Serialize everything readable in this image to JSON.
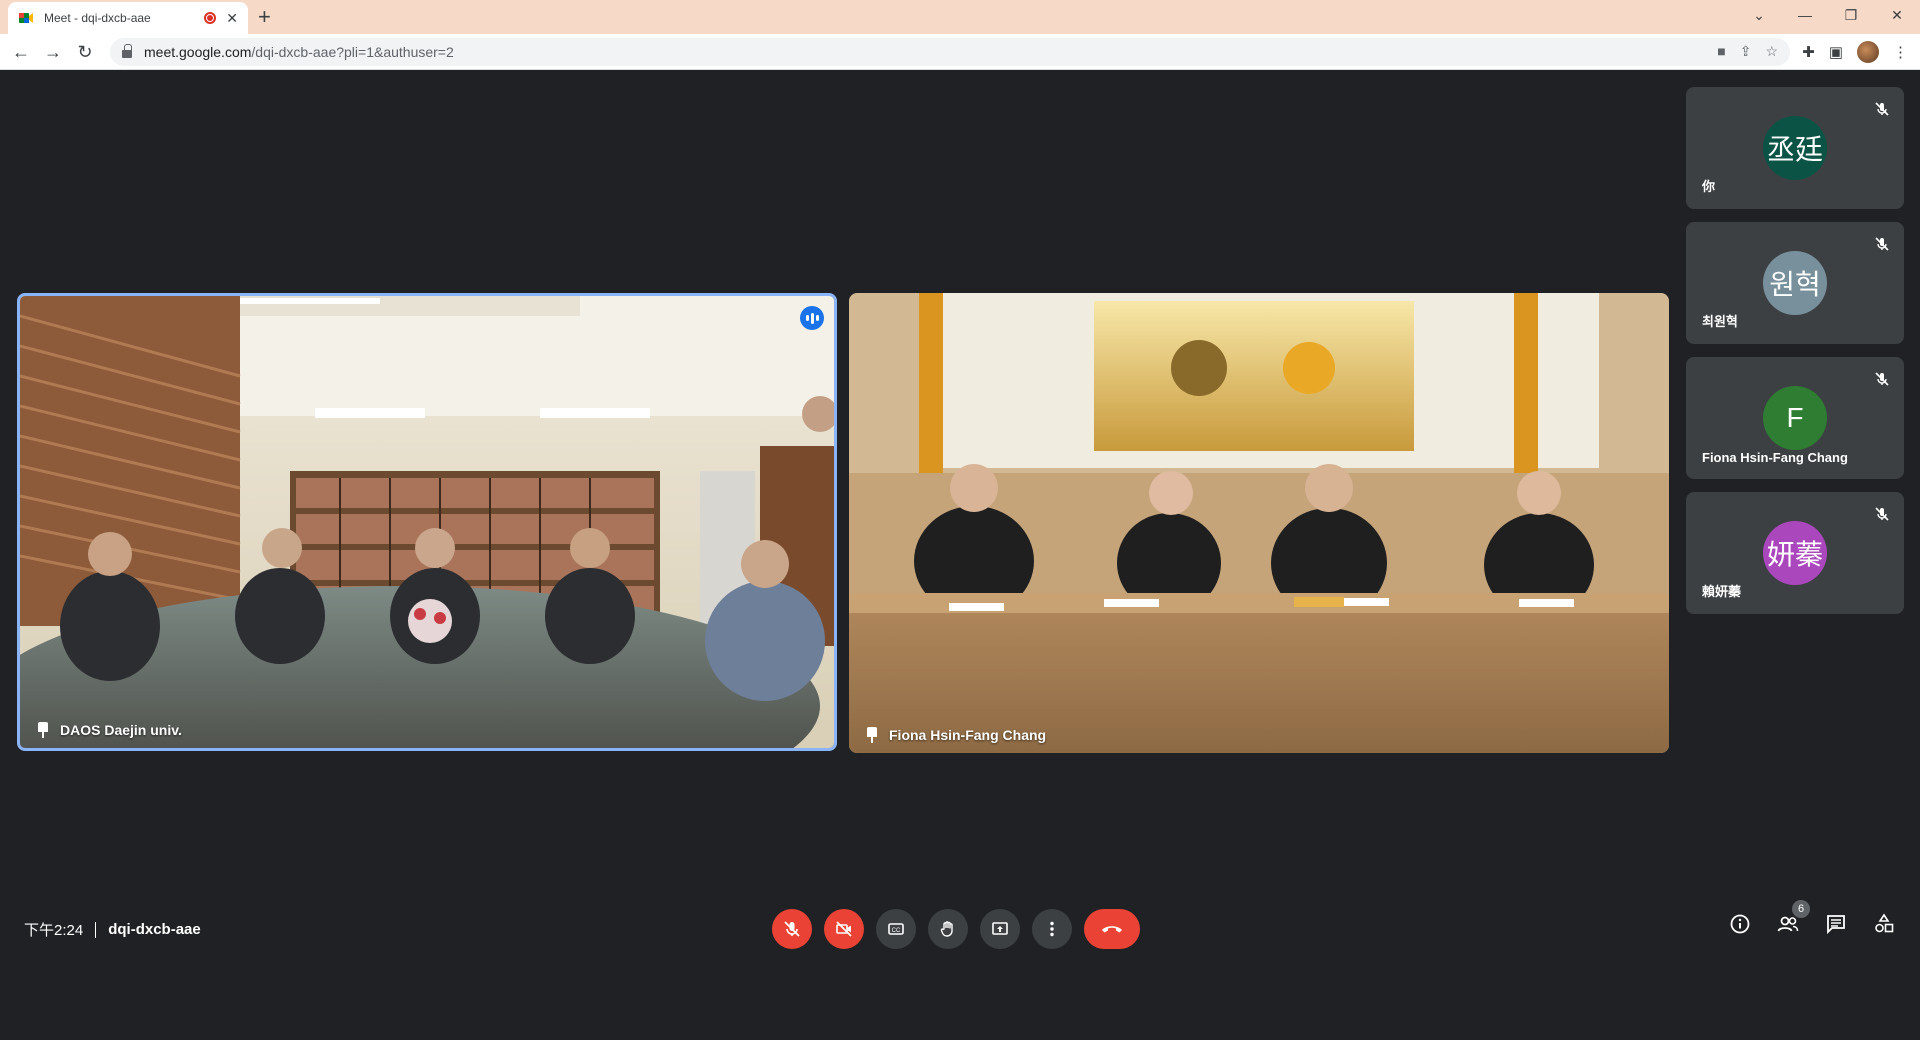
{
  "browser": {
    "tab_title": "Meet - dqi-dxcb-aae",
    "new_tab": "+",
    "url_host": "meet.google.com",
    "url_path": "/dqi-dxcb-aae?pli=1&authuser=2"
  },
  "main_tiles": [
    {
      "name": "DAOS Daejin univ."
    },
    {
      "name": "Fiona Hsin-Fang Chang"
    }
  ],
  "sidebar": [
    {
      "initials": "丞廷",
      "name": "你",
      "color": "#0b5345"
    },
    {
      "initials": "원혁",
      "name": "최원혁",
      "color": "#78909c"
    },
    {
      "initials": "F",
      "name": "Fiona Hsin-Fang Chang",
      "color": "#2e7d32"
    },
    {
      "initials": "妍蓁",
      "name": "賴妍蓁",
      "color": "#ab47bc"
    }
  ],
  "meeting": {
    "time": "下午2:24",
    "code": "dqi-dxcb-aae",
    "participants_count": "6"
  },
  "colors": {
    "accent": "#8ab4f8",
    "danger": "#ea4335",
    "bg": "#202124"
  }
}
